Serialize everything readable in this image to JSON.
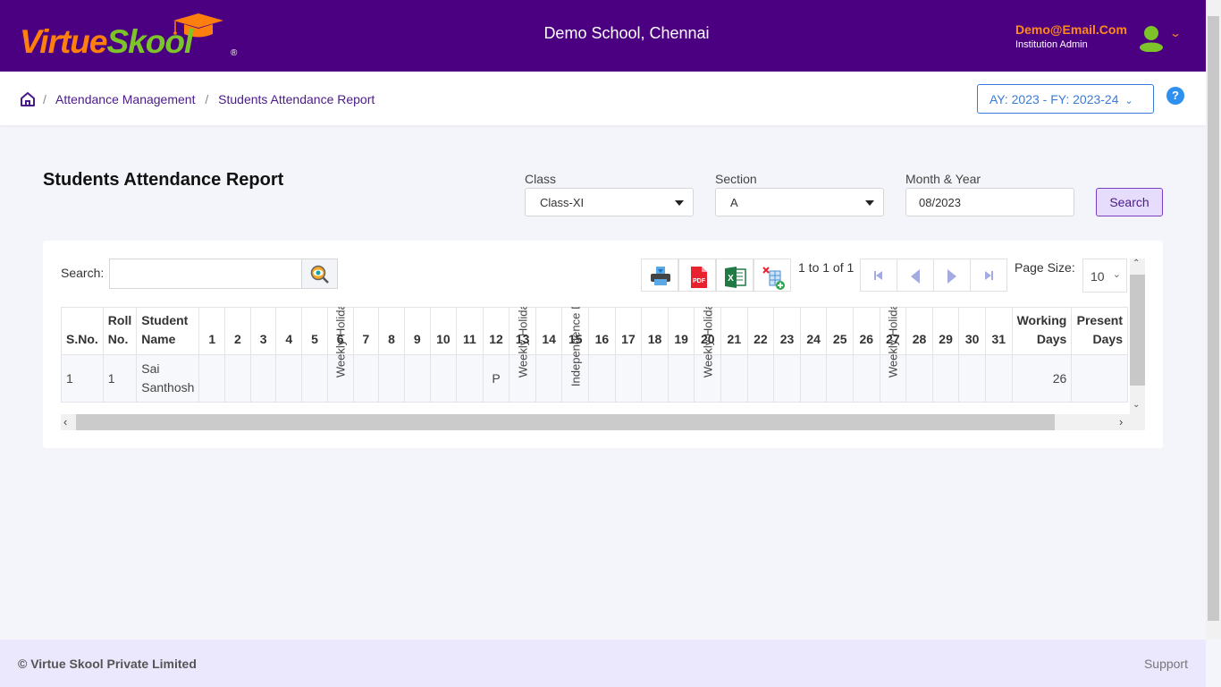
{
  "header": {
    "logo_part1": "Virtue",
    "logo_part2": "Skool",
    "logo_reg": "®",
    "school_name": "Demo School, Chennai",
    "user_email": "Demo@Email.Com",
    "user_role": "Institution Admin"
  },
  "breadcrumb": {
    "items": [
      "Attendance Management",
      "Students Attendance Report"
    ],
    "separator": "/"
  },
  "academic_year": "AY: 2023 - FY: 2023-24",
  "help_label": "?",
  "page": {
    "title": "Students Attendance Report"
  },
  "filters": {
    "class_label": "Class",
    "class_value": "Class-XI",
    "section_label": "Section",
    "section_value": "A",
    "month_label": "Month & Year",
    "month_value": "08/2023",
    "search_button": "Search"
  },
  "grid": {
    "search_label": "Search:",
    "search_value": "",
    "toolbar": [
      "print-icon",
      "pdf-icon",
      "excel-icon",
      "clear-filter-icon"
    ],
    "pdf_text": "PDF",
    "paging_info": "1 to 1 of 1",
    "page_size_label": "Page Size:",
    "page_size_value": "10",
    "columns": {
      "sno": "S.No.",
      "roll_1": "Roll",
      "roll_2": "No.",
      "name_1": "Student",
      "name_2": "Name",
      "days": [
        "1",
        "2",
        "3",
        "4",
        "5",
        "6",
        "7",
        "8",
        "9",
        "10",
        "11",
        "12",
        "13",
        "14",
        "15",
        "16",
        "17",
        "18",
        "19",
        "20",
        "21",
        "22",
        "23",
        "24",
        "25",
        "26",
        "27",
        "28",
        "29",
        "30",
        "31"
      ],
      "working_1": "Working",
      "working_2": "Days",
      "present_1": "Present",
      "present_2": "Days"
    },
    "rows": [
      {
        "sno": "1",
        "roll": "1",
        "name_1": "Sai",
        "name_2": "Santhosh",
        "days": [
          "",
          "",
          "",
          "",
          "",
          "Weekly Holiday",
          "",
          "",
          "",
          "",
          "",
          "P",
          "Weekly Holiday",
          "",
          "Independence Day",
          "",
          "",
          "",
          "",
          "Weekly Holiday",
          "",
          "",
          "",
          "",
          "",
          "",
          "Weekly Holiday",
          "",
          "",
          "",
          ""
        ],
        "working_days": "26",
        "present_days": ""
      }
    ]
  },
  "footer": {
    "copyright": "© Virtue Skool Private Limited",
    "support": "Support"
  }
}
